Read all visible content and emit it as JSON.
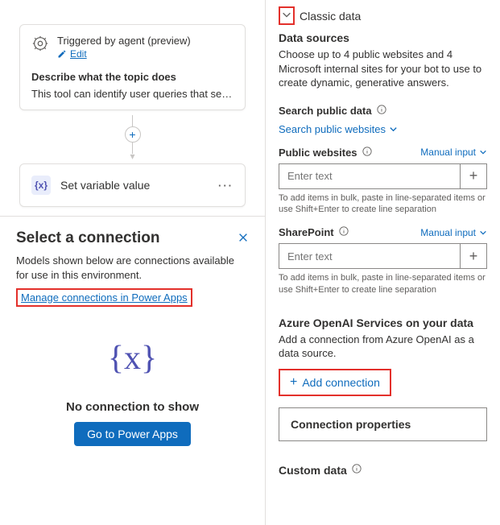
{
  "canvas": {
    "trigger": {
      "title": "Triggered by agent (preview)",
      "edit": "Edit",
      "describe_label": "Describe what the topic does",
      "describe_text": "This tool can identify user queries that seek f…"
    },
    "setvar": {
      "icon_text": "{x}",
      "title": "Set variable value"
    }
  },
  "panel": {
    "title": "Select a connection",
    "desc": "Models shown below are connections available for use in this environment.",
    "manage_link": "Manage connections in Power Apps",
    "empty_glyph": "{x}",
    "empty_title": "No connection to show",
    "go_button": "Go to Power Apps"
  },
  "right": {
    "classic_title": "Classic data",
    "data_sources_title": "Data sources",
    "data_sources_desc": "Choose up to 4 public websites and 4 Microsoft internal sites for your bot to use to create dynamic, generative answers.",
    "search_public_label": "Search public data",
    "search_public_link": "Search public websites",
    "public_sites_label": "Public websites",
    "manual_input": "Manual input",
    "placeholder": "Enter text",
    "bulk_hint": "To add items in bulk, paste in line-separated items or use Shift+Enter to create line separation",
    "sharepoint_label": "SharePoint",
    "azure_title": "Azure OpenAI Services on your data",
    "azure_desc": "Add a connection from Azure OpenAI as a data source.",
    "add_connection": "Add connection",
    "conn_props": "Connection properties",
    "custom_data": "Custom data"
  }
}
